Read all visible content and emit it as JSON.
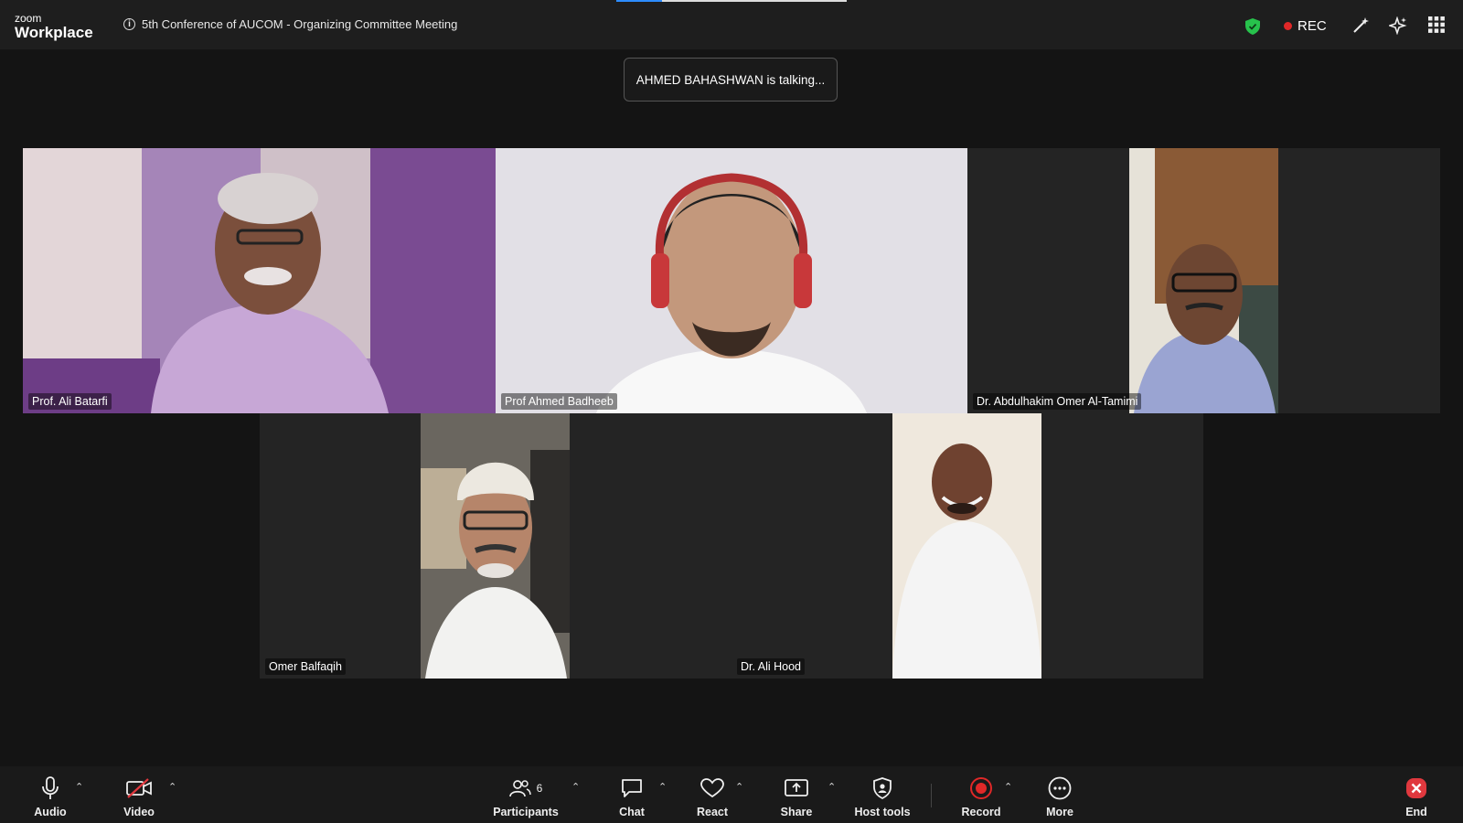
{
  "app": {
    "brand": "zoom",
    "product": "Workplace"
  },
  "meeting": {
    "title": "5th Conference of AUCOM - Organizing Committee Meeting"
  },
  "status": {
    "rec_label": "REC"
  },
  "banner": {
    "speaker_text": "AHMED BAHASHWAN is talking..."
  },
  "participants": [
    {
      "name": "Prof. Ali Batarfi"
    },
    {
      "name": "Prof Ahmed Badheeb"
    },
    {
      "name": "Dr. Abdulhakim Omer Al-Tamimi"
    },
    {
      "name": "Omer Balfaqih"
    },
    {
      "name": "Dr. Ali Hood"
    }
  ],
  "toolbar": {
    "audio": "Audio",
    "video": "Video",
    "participants": "Participants",
    "participants_count": "6",
    "chat": "Chat",
    "react": "React",
    "share": "Share",
    "host_tools": "Host tools",
    "record": "Record",
    "more": "More",
    "end": "End"
  },
  "colors": {
    "accent": "#2d8cff",
    "rec": "#e02828",
    "security": "#27c24c",
    "end": "#e0383e"
  },
  "icons": [
    "info-icon",
    "security-shield-icon",
    "magic-wand-icon",
    "sparkle-icon",
    "apps-grid-icon",
    "microphone-icon",
    "video-off-icon",
    "participants-icon",
    "chat-icon",
    "react-heart-icon",
    "share-screen-icon",
    "host-tools-icon",
    "record-icon",
    "more-icon",
    "end-icon"
  ]
}
